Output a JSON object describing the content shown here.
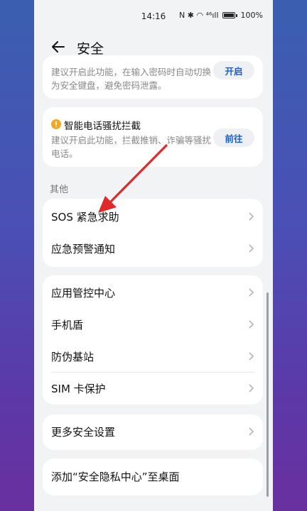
{
  "status_bar": {
    "time": "14:16",
    "icons_text": "N ✱ ◠ ⁴⁶ıll",
    "battery": "100%"
  },
  "header": {
    "title": "安全"
  },
  "card_keyboard": {
    "description": "建议开启此功能，在输入密码时自动切换为安全键盘，避免密码泄露。",
    "button": "开启"
  },
  "card_call": {
    "title": "智能电话骚扰拦截",
    "description": "建议开启此功能，拦截推销、诈骗等骚扰电话。",
    "button": "前往",
    "warning_color": "#f5a623"
  },
  "section_other": {
    "label": "其他"
  },
  "group_emergency": {
    "items": [
      {
        "label": "SOS 紧急求助"
      },
      {
        "label": "应急预警通知"
      }
    ]
  },
  "group_security": {
    "items": [
      {
        "label": "应用管控中心"
      },
      {
        "label": "手机盾"
      },
      {
        "label": "防伪基站"
      },
      {
        "label": "SIM 卡保护"
      }
    ]
  },
  "group_more": {
    "items": [
      {
        "label": "更多安全设置"
      }
    ]
  },
  "group_desktop": {
    "items": [
      {
        "label": "添加“安全隐私中心”至桌面"
      }
    ]
  },
  "annotation": {
    "arrow_color": "#e02a2a"
  }
}
